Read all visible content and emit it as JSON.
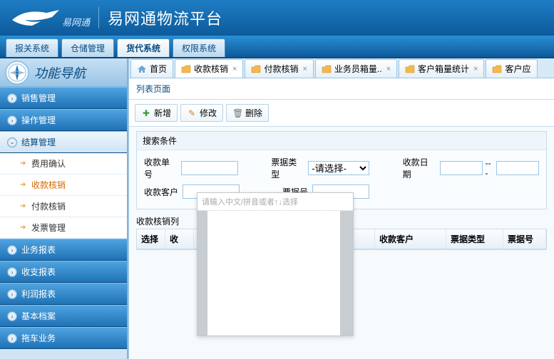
{
  "header": {
    "brand": "易网通",
    "title": "易网通物流平台"
  },
  "nav": {
    "items": [
      "报关系统",
      "仓储管理",
      "货代系统",
      "权限系统"
    ],
    "active": 2
  },
  "sidebar": {
    "title": "功能导航",
    "groups": [
      {
        "label": "销售管理",
        "expanded": false
      },
      {
        "label": "操作管理",
        "expanded": false
      },
      {
        "label": "结算管理",
        "expanded": true,
        "items": [
          {
            "label": "费用确认",
            "active": false
          },
          {
            "label": "收款核销",
            "active": true
          },
          {
            "label": "付款核销",
            "active": false
          },
          {
            "label": "发票管理",
            "active": false
          }
        ]
      },
      {
        "label": "业务报表",
        "expanded": false
      },
      {
        "label": "收支报表",
        "expanded": false
      },
      {
        "label": "利润报表",
        "expanded": false
      },
      {
        "label": "基本档案",
        "expanded": false
      },
      {
        "label": "拖车业务",
        "expanded": false
      }
    ]
  },
  "main": {
    "tabs": [
      {
        "label": "首页",
        "icon": "home",
        "closable": false
      },
      {
        "label": "收款核销",
        "icon": "folder",
        "closable": true,
        "active": true
      },
      {
        "label": "付款核销",
        "icon": "folder",
        "closable": true
      },
      {
        "label": "业务员箱量..",
        "icon": "folder",
        "closable": true
      },
      {
        "label": "客户箱量统计",
        "icon": "folder",
        "closable": true
      },
      {
        "label": "客户应",
        "icon": "folder",
        "closable": false
      }
    ],
    "subtab": "列表页面",
    "toolbar": {
      "add": "新增",
      "edit": "修改",
      "del": "删除"
    },
    "search": {
      "legend": "搜索条件",
      "receipt_no_label": "收款单号",
      "bill_type_label": "票据类型",
      "bill_type_placeholder": "-请选择-",
      "receipt_date_label": "收款日期",
      "date_sep": "---",
      "customer_label": "收款客户",
      "bill_no_label": "票据号"
    },
    "grid": {
      "title": "收款核销列",
      "cols": [
        "选择",
        "收",
        "",
        "收款客户",
        "票据类型",
        "票据号"
      ]
    },
    "popup_hint": "请输入中文/拼音或者↑↓选择"
  }
}
